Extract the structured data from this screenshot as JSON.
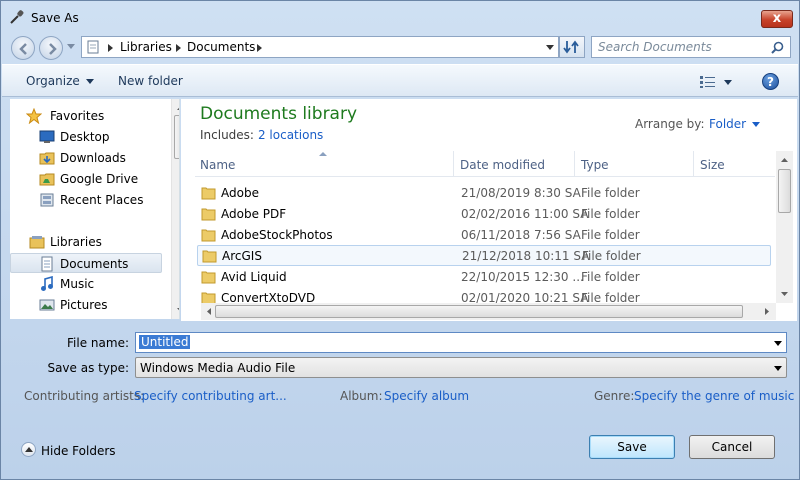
{
  "window": {
    "title": "Save As",
    "close_label": "x"
  },
  "address": {
    "crumbs": [
      "Libraries",
      "Documents"
    ],
    "search_placeholder": "Search Documents"
  },
  "toolbar": {
    "organize": "Organize",
    "new_folder": "New folder",
    "help": "?"
  },
  "nav": {
    "items": [
      {
        "label": "Favorites",
        "icon": "star-icon"
      },
      {
        "label": "Desktop",
        "icon": "desktop-icon"
      },
      {
        "label": "Downloads",
        "icon": "downloads-folder-icon"
      },
      {
        "label": "Google Drive",
        "icon": "google-drive-folder-icon"
      },
      {
        "label": "Recent Places",
        "icon": "recent-places-icon"
      },
      {
        "label": "Libraries",
        "icon": "libraries-icon"
      },
      {
        "label": "Documents",
        "icon": "documents-icon",
        "selected": true
      },
      {
        "label": "Music",
        "icon": "music-icon"
      },
      {
        "label": "Pictures",
        "icon": "pictures-icon"
      }
    ]
  },
  "library": {
    "title": "Documents library",
    "includes_label": "Includes:",
    "locations": "2 locations",
    "arrange_label": "Arrange by:",
    "arrange_value": "Folder"
  },
  "columns": {
    "name": "Name",
    "date": "Date modified",
    "type": "Type",
    "size": "Size"
  },
  "files": [
    {
      "name": "Adobe",
      "date": "21/08/2019 8:30 SA",
      "type": "File folder"
    },
    {
      "name": "Adobe PDF",
      "date": "02/02/2016 11:00 SA",
      "type": "File folder"
    },
    {
      "name": "AdobeStockPhotos",
      "date": "06/11/2018 7:56 SA",
      "type": "File folder"
    },
    {
      "name": "ArcGIS",
      "date": "21/12/2018 10:11 SA",
      "type": "File folder",
      "hover": true
    },
    {
      "name": "Avid Liquid",
      "date": "22/10/2015 12:30 ...",
      "type": "File folder"
    },
    {
      "name": "ConvertXtoDVD",
      "date": "02/01/2020 10:21 SA",
      "type": "File folder"
    }
  ],
  "form": {
    "filename_label": "File name:",
    "filename_value": "Untitled",
    "savetype_label": "Save as type:",
    "savetype_value": "Windows Media Audio File"
  },
  "meta": {
    "artists_label": "Contributing artists:",
    "artists_link": "Specify contributing art...",
    "album_label": "Album:",
    "album_link": "Specify album",
    "genre_label": "Genre:",
    "genre_link": "Specify the genre of music"
  },
  "footer": {
    "hide_folders": "Hide Folders",
    "save": "Save",
    "cancel": "Cancel"
  },
  "colors": {
    "library_title": "#1e7a1e",
    "link": "#1a5ec7",
    "selection": "#3b7bd4"
  }
}
